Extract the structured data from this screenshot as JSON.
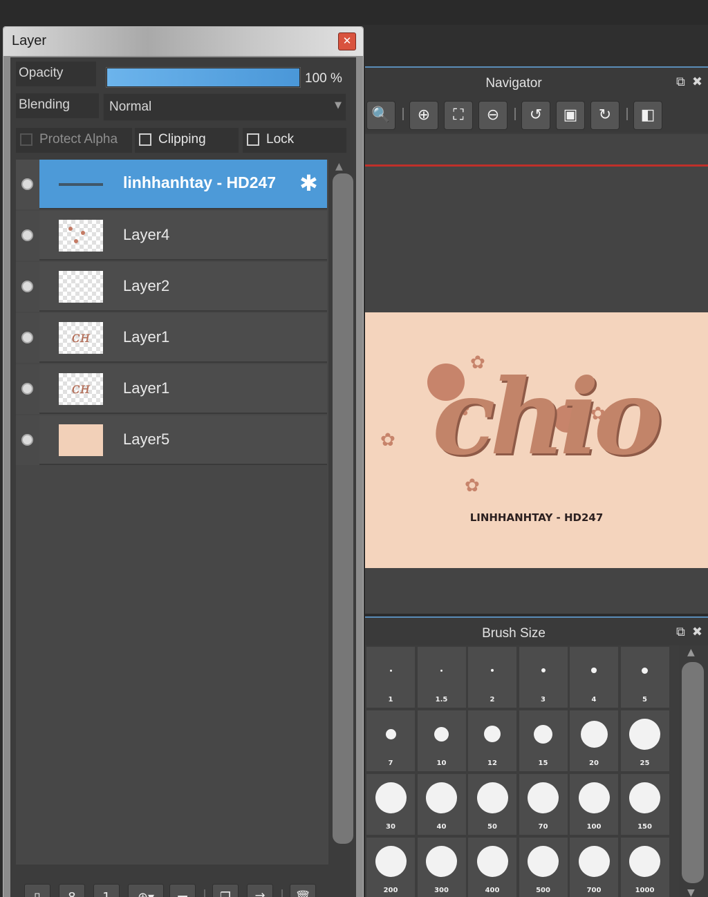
{
  "layer_window": {
    "title": "Layer",
    "close_icon": "close-icon",
    "opacity_label": "Opacity",
    "opacity_value": "100 %",
    "opacity_fraction": 1.0,
    "blending_label": "Blending",
    "blending_value": "Normal",
    "protect_alpha_label": "Protect Alpha",
    "clipping_label": "Clipping",
    "lock_label": "Lock",
    "layers": [
      {
        "name": "linhhanhtay - HD247",
        "selected": true,
        "type": "text"
      },
      {
        "name": "Layer4",
        "selected": false,
        "type": "dots"
      },
      {
        "name": "Layer2",
        "selected": false,
        "type": "empty"
      },
      {
        "name": "Layer1",
        "selected": false,
        "type": "art"
      },
      {
        "name": "Layer1",
        "selected": false,
        "type": "art"
      },
      {
        "name": "Layer5",
        "selected": false,
        "type": "solid"
      }
    ],
    "toolbar_icons": [
      "new-layer-icon",
      "new-8bit-layer-icon",
      "new-1bit-layer-icon",
      "add-layer-dropdown-icon",
      "new-folder-icon",
      "duplicate-layer-icon",
      "merge-layer-icon",
      "delete-layer-icon"
    ]
  },
  "navigator": {
    "title": "Navigator",
    "icons": [
      "zoom-fit-icon",
      "zoom-in-icon",
      "fit-screen-icon",
      "zoom-out-icon",
      "rotate-left-icon",
      "actual-size-icon",
      "rotate-right-icon",
      "flip-icon"
    ],
    "canvas_text": "chio",
    "canvas_caption": "LINHHANHTAY - HD247",
    "accent_color": "#c7846b",
    "canvas_bg": "#f4d4bd"
  },
  "brush_size": {
    "title": "Brush Size",
    "sizes": [
      "1",
      "1.5",
      "2",
      "3",
      "4",
      "5",
      "7",
      "10",
      "12",
      "15",
      "20",
      "25",
      "30",
      "40",
      "50",
      "70",
      "100",
      "150",
      "200",
      "300",
      "400",
      "500",
      "700",
      "1000"
    ]
  },
  "colors": {
    "selected_row": "#4d9ad8",
    "opacity_fill": "#5aa6e2",
    "close_button": "#d9533e",
    "guide_line": "#c0302a"
  }
}
